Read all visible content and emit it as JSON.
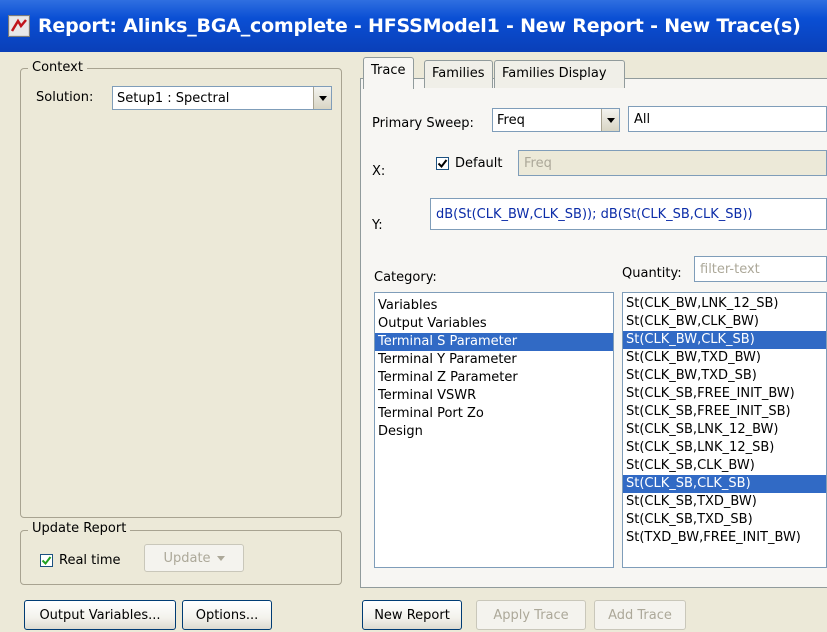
{
  "window": {
    "title": "Report: Alinks_BGA_complete - HFSSModel1 - New Report - New Trace(s)"
  },
  "context": {
    "legend": "Context",
    "solution_label": "Solution:",
    "solution_value": "Setup1 : Spectral"
  },
  "update_report": {
    "legend": "Update Report",
    "realtime_label": "Real time",
    "realtime_checked": true,
    "update_button": "Update"
  },
  "tabs": [
    {
      "label": "Trace",
      "active": true
    },
    {
      "label": "Families",
      "active": false
    },
    {
      "label": "Families Display",
      "active": false
    }
  ],
  "trace": {
    "primary_sweep_label": "Primary Sweep:",
    "primary_sweep_value": "Freq",
    "sweep_range_value": "All",
    "x_label": "X:",
    "x_default_label": "Default",
    "x_default_checked": true,
    "x_value": "Freq",
    "y_label": "Y:",
    "y_value": "dB(St(CLK_BW,CLK_SB)); dB(St(CLK_SB,CLK_SB))",
    "category_label": "Category:",
    "quantity_label": "Quantity:",
    "quantity_filter_placeholder": "filter-text"
  },
  "categories": [
    {
      "label": "Variables",
      "selected": false
    },
    {
      "label": "Output Variables",
      "selected": false
    },
    {
      "label": "Terminal S Parameter",
      "selected": true
    },
    {
      "label": "Terminal Y Parameter",
      "selected": false
    },
    {
      "label": "Terminal Z Parameter",
      "selected": false
    },
    {
      "label": "Terminal VSWR",
      "selected": false
    },
    {
      "label": "Terminal Port Zo",
      "selected": false
    },
    {
      "label": "Design",
      "selected": false
    }
  ],
  "quantities": [
    {
      "label": "St(CLK_BW,LNK_12_SB)",
      "selected": false
    },
    {
      "label": "St(CLK_BW,CLK_BW)",
      "selected": false
    },
    {
      "label": "St(CLK_BW,CLK_SB)",
      "selected": true
    },
    {
      "label": "St(CLK_BW,TXD_BW)",
      "selected": false
    },
    {
      "label": "St(CLK_BW,TXD_SB)",
      "selected": false
    },
    {
      "label": "St(CLK_SB,FREE_INIT_BW)",
      "selected": false
    },
    {
      "label": "St(CLK_SB,FREE_INIT_SB)",
      "selected": false
    },
    {
      "label": "St(CLK_SB,LNK_12_BW)",
      "selected": false
    },
    {
      "label": "St(CLK_SB,LNK_12_SB)",
      "selected": false
    },
    {
      "label": "St(CLK_SB,CLK_BW)",
      "selected": false
    },
    {
      "label": "St(CLK_SB,CLK_SB)",
      "selected": true
    },
    {
      "label": "St(CLK_SB,TXD_BW)",
      "selected": false
    },
    {
      "label": "St(CLK_SB,TXD_SB)",
      "selected": false
    },
    {
      "label": "St(TXD_BW,FREE_INIT_BW)",
      "selected": false
    }
  ],
  "bottom_buttons": {
    "output_variables": "Output Variables...",
    "options": "Options...",
    "new_report": "New Report",
    "apply_trace": "Apply Trace",
    "add_trace": "Add Trace"
  },
  "colors": {
    "titlebar": "#0a4fd4",
    "selection": "#316ac5",
    "dialog_bg": "#ece9d8"
  }
}
